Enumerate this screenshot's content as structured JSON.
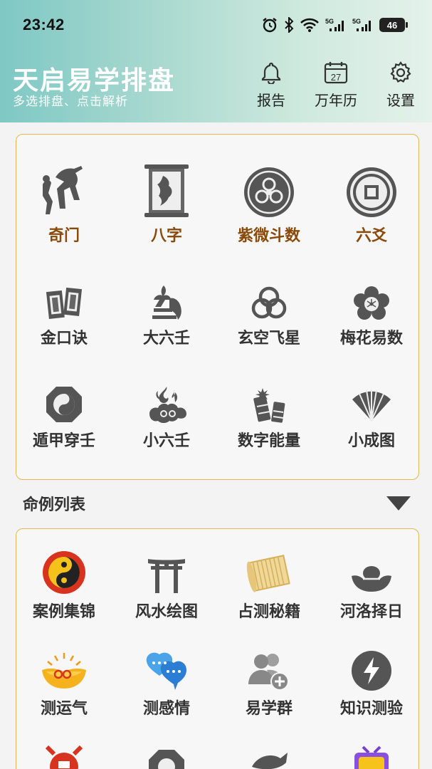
{
  "status": {
    "time": "23:42",
    "battery": "46",
    "signal_1": "5G",
    "signal_2": "5G"
  },
  "header": {
    "title": "天启易学排盘",
    "subtitle": "多选排盘、点击解析",
    "buttons": [
      {
        "label": "报告",
        "icon": "bell-icon"
      },
      {
        "label": "万年历",
        "icon": "calendar-icon",
        "calendar_day": "27"
      },
      {
        "label": "设置",
        "icon": "gear-icon"
      }
    ]
  },
  "divination_tools": [
    {
      "label": "奇门",
      "icon": "qimen-icon",
      "color": "#8a4a0a"
    },
    {
      "label": "八字",
      "icon": "bazi-scroll-icon",
      "color": "#8a4a0a"
    },
    {
      "label": "紫微斗数",
      "icon": "ziwei-disc-icon",
      "color": "#8a4a0a"
    },
    {
      "label": "六爻",
      "icon": "liuyao-coin-icon",
      "color": "#8a4a0a"
    },
    {
      "label": "金口诀",
      "icon": "jinkoujue-tablets-icon"
    },
    {
      "label": "大六壬",
      "icon": "daliuren-icon"
    },
    {
      "label": "玄空飞星",
      "icon": "xuankong-rings-icon"
    },
    {
      "label": "梅花易数",
      "icon": "plum-blossom-icon"
    },
    {
      "label": "遁甲穿壬",
      "icon": "bagua-icon"
    },
    {
      "label": "小六壬",
      "icon": "cloud-flame-icon"
    },
    {
      "label": "数字能量",
      "icon": "firecracker-icon"
    },
    {
      "label": "小成图",
      "icon": "folding-fan-icon"
    }
  ],
  "section": {
    "title": "命例列表"
  },
  "features": [
    {
      "label": "案例集锦",
      "icon": "yinyang-icon"
    },
    {
      "label": "风水绘图",
      "icon": "torii-gate-icon"
    },
    {
      "label": "占测秘籍",
      "icon": "bamboo-scroll-icon"
    },
    {
      "label": "河洛择日",
      "icon": "gold-ingot-icon"
    },
    {
      "label": "测运气",
      "icon": "lucky-ingot-icon"
    },
    {
      "label": "测感情",
      "icon": "chat-hearts-icon"
    },
    {
      "label": "易学群",
      "icon": "add-group-icon"
    },
    {
      "label": "知识测验",
      "icon": "lightning-icon"
    }
  ],
  "colors": {
    "accent_brown": "#8a4a0a",
    "card_border": "#e4b84c",
    "header_teal": "#7fc8c4"
  }
}
